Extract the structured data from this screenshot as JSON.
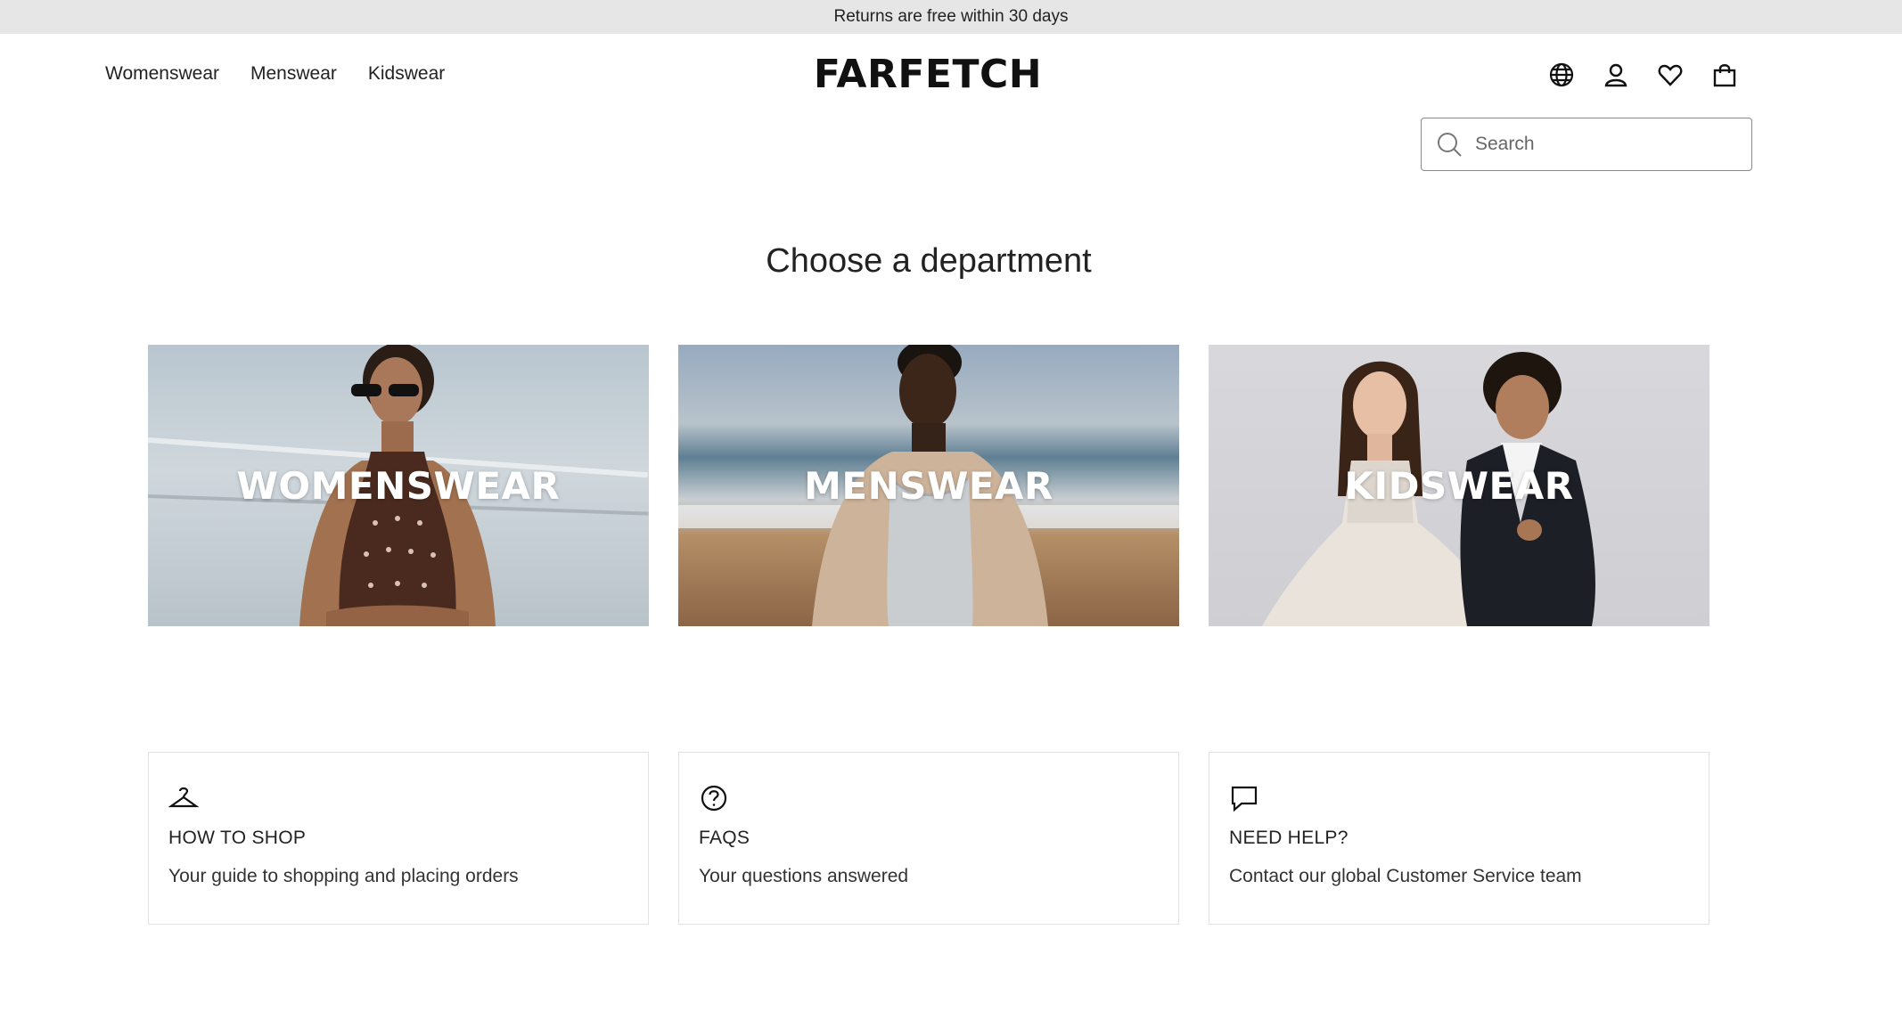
{
  "promo": {
    "text": "Returns are free within 30 days"
  },
  "header": {
    "nav": [
      {
        "label": "Womenswear"
      },
      {
        "label": "Menswear"
      },
      {
        "label": "Kidswear"
      }
    ],
    "logo": "FARFETCH",
    "icons": [
      "globe-icon",
      "account-icon",
      "wishlist-heart-icon",
      "shopping-bag-icon"
    ]
  },
  "search": {
    "placeholder": "Search",
    "value": ""
  },
  "main": {
    "title": "Choose a department",
    "departments": [
      {
        "label": "WOMENSWEAR"
      },
      {
        "label": "MENSWEAR"
      },
      {
        "label": "KIDSWEAR"
      }
    ],
    "help_cards": [
      {
        "icon": "hanger-icon",
        "title": "HOW TO SHOP",
        "text": "Your guide to shopping and placing orders"
      },
      {
        "icon": "question-circle-icon",
        "title": "FAQS",
        "text": "Your questions answered"
      },
      {
        "icon": "chat-bubble-icon",
        "title": "NEED HELP?",
        "text": "Contact our global Customer Service team"
      }
    ]
  },
  "colors": {
    "promo_bg": "#e6e6e6",
    "text": "#222222",
    "card_border": "#e2e2e2"
  }
}
